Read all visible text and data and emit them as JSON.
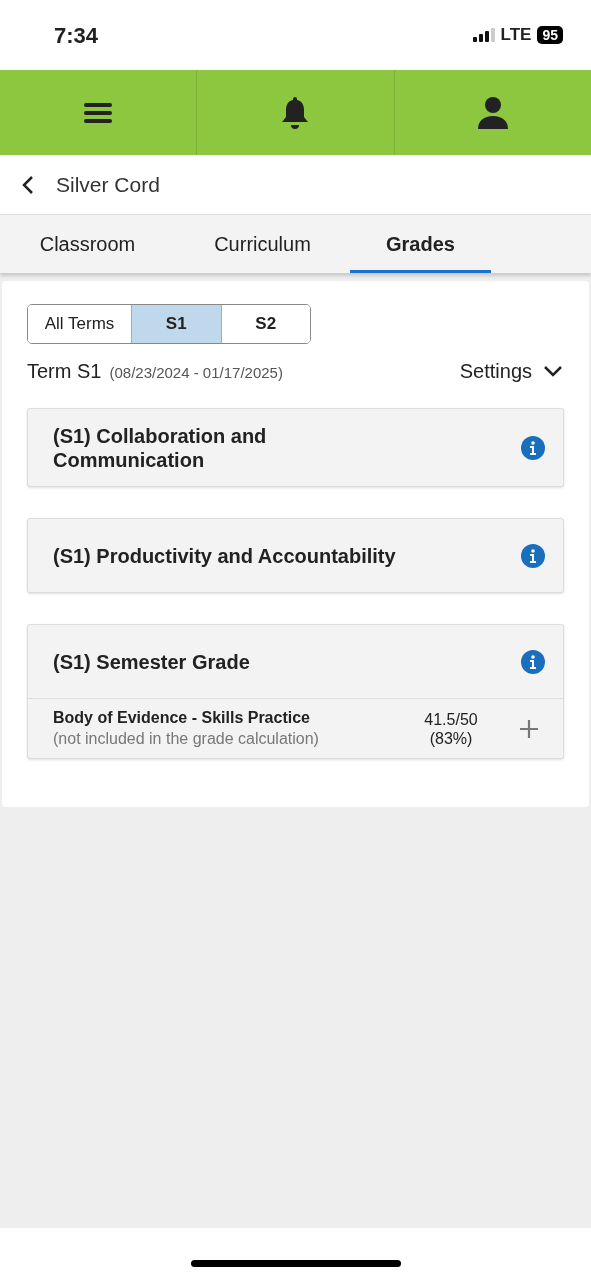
{
  "status_bar": {
    "time": "7:34",
    "network": "LTE",
    "battery": "95"
  },
  "header": {
    "title": "Silver Cord"
  },
  "tabs": [
    {
      "label": "Classroom",
      "selected": false
    },
    {
      "label": "Curriculum",
      "selected": false
    },
    {
      "label": "Grades",
      "selected": true
    }
  ],
  "term_filter": [
    {
      "label": "All Terms",
      "selected": false
    },
    {
      "label": "S1",
      "selected": true
    },
    {
      "label": "S2",
      "selected": false
    }
  ],
  "term": {
    "label": "Term S1",
    "dates": "(08/23/2024 - 01/17/2025)",
    "settings": "Settings"
  },
  "categories": [
    {
      "title": "(S1) Collaboration and Communication"
    },
    {
      "title": "(S1) Productivity and Accountability"
    },
    {
      "title": "(S1) Semester Grade",
      "items": [
        {
          "name": "Body of Evidence - Skills Practice",
          "note": "(not included in the grade calculation)",
          "score": "41.5/50",
          "percent": "(83%)"
        }
      ]
    }
  ]
}
